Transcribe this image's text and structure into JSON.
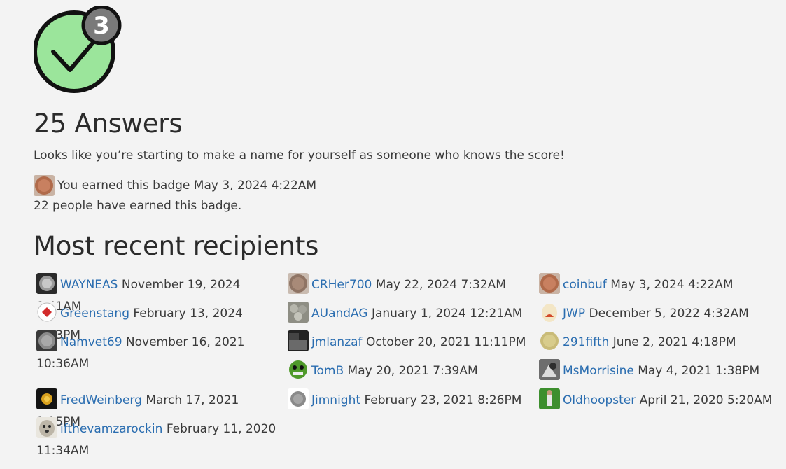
{
  "badge": {
    "count": "3",
    "fill_color": "#9be59b",
    "icon": "checkmark-icon"
  },
  "title": "25 Answers",
  "description": "Looks like you’re starting to make a name for yourself as someone who knows the score!",
  "earned": {
    "text": "You earned this badge May 3, 2024 4:22AM"
  },
  "people_count_text": "22 people have earned this badge.",
  "recent_heading": "Most recent recipients",
  "recipients": [
    {
      "username": "WAYNEAS",
      "date": "November 19, 2024 8:41AM"
    },
    {
      "username": "CRHer700",
      "date": "May 22, 2024 7:32AM"
    },
    {
      "username": "coinbuf",
      "date": "May 3, 2024 4:22AM"
    },
    {
      "username": "Greenstang",
      "date": "February 13, 2024 3:13PM"
    },
    {
      "username": "AUandAG",
      "date": "January 1, 2024 12:21AM"
    },
    {
      "username": "JWP",
      "date": "December 5, 2022 4:32AM"
    },
    {
      "username": "Namvet69",
      "date": "November 16, 2021 10:36AM"
    },
    {
      "username": "jmlanzaf",
      "date": "October 20, 2021 11:11PM"
    },
    {
      "username": "291fifth",
      "date": "June 2, 2021 4:18PM"
    },
    {
      "username": "TomB",
      "date": "May 20, 2021 7:39AM"
    },
    {
      "username": "MsMorrisine",
      "date": "May 4, 2021 1:38PM"
    },
    {
      "username": "FredWeinberg",
      "date": "March 17, 2021 1:15PM"
    },
    {
      "username": "Jimnight",
      "date": "February 23, 2021 8:26PM"
    },
    {
      "username": "Oldhoopster",
      "date": "April 21, 2020 5:20AM"
    },
    {
      "username": "ifthevamzarockin",
      "date": "February 11, 2020 11:34AM"
    }
  ],
  "colors": {
    "link": "#2a6db0",
    "background": "#f3f3f3",
    "text": "#3a3a3a",
    "badge_count_bg": "#7a7a7a"
  }
}
